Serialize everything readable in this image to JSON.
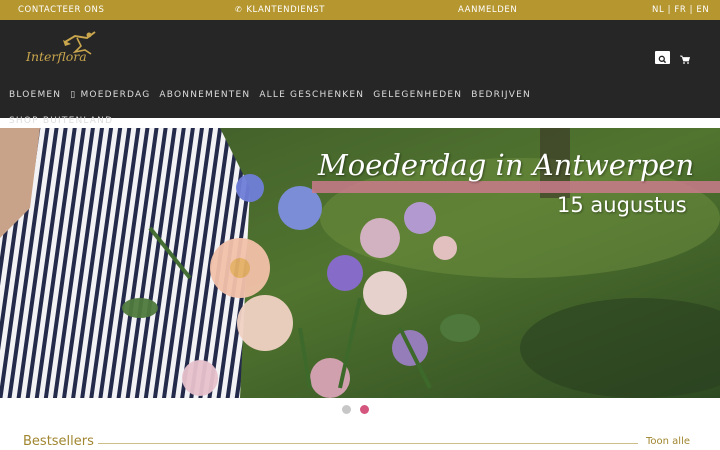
{
  "topbar": {
    "contact": "CONTACTEER ONS",
    "customer_service": "KLANTENDIENST",
    "login": "AANMELDEN",
    "languages": "NL | FR | EN"
  },
  "header": {
    "logo_text": "Interflora",
    "nav": {
      "items": [
        "BLOEMEN",
        "▯ MOEDERDAG",
        "ABONNEMENTEN",
        "ALLE GESCHENKEN",
        "GELEGENHEDEN",
        "BEDRIJVEN"
      ],
      "second_row": "SHOP BUITENLAND"
    }
  },
  "hero": {
    "title": "Moederdag in Antwerpen",
    "subtitle": "15 augustus"
  },
  "carousel": {
    "slides": 2,
    "active": 2
  },
  "section": {
    "title": "Bestsellers",
    "link": "Toon alle"
  },
  "colors": {
    "topbar": "#b5962f",
    "header": "#262626",
    "gold_text": "#a0862f",
    "active_dot": "#d4557d",
    "banner_stripe": "#c97a8b"
  },
  "icons": {
    "phone": "phone-icon",
    "search": "search-icon",
    "cart": "cart-icon",
    "logo": "interflora-mercury-logo"
  }
}
